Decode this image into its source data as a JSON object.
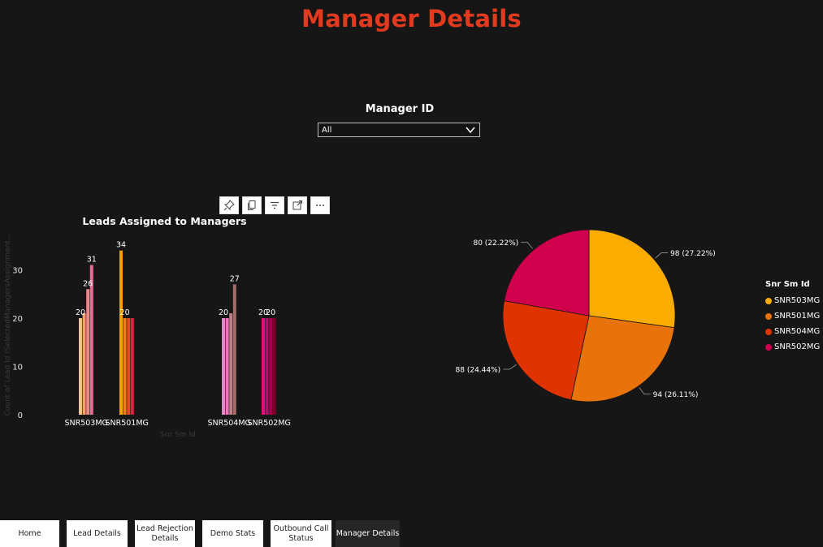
{
  "page": {
    "title": "Manager Details"
  },
  "slicer": {
    "title": "Manager ID",
    "selected": "All"
  },
  "visual_toolbar": {
    "icons": [
      "pin-icon",
      "copy-icon",
      "filter-icon",
      "focus-mode-icon",
      "more-options-icon"
    ]
  },
  "bar_chart": {
    "title": "Leads Assigned to Managers",
    "y_axis_title": "Count of Lead Id (SelectedManagersAssignment...",
    "x_axis_title": "Snr Sm Id"
  },
  "chart_data": [
    {
      "type": "bar",
      "title": "Leads Assigned to Managers",
      "xlabel": "Snr Sm Id",
      "ylabel": "Count of Lead Id (SelectedManagersAssignment...",
      "ylim": [
        0,
        35
      ],
      "y_ticks": [
        0,
        10,
        20,
        30
      ],
      "categories": [
        "SNR503MG",
        "SNR501MG",
        "SNR504MG",
        "SNR502MG"
      ],
      "groups": [
        {
          "category": "SNR503MG",
          "bars": [
            {
              "value": 20,
              "color": "#f2c878",
              "label": "20"
            },
            {
              "value": 21,
              "color": "#f0a070",
              "label": ""
            },
            {
              "value": 26,
              "color": "#ea8a8a",
              "label": "26"
            },
            {
              "value": 31,
              "color": "#e86a94",
              "label": "31"
            }
          ]
        },
        {
          "category": "SNR501MG",
          "bars": [
            {
              "value": 34,
              "color": "#f5a200",
              "label": "34"
            },
            {
              "value": 20,
              "color": "#f07e1a",
              "label": "20"
            },
            {
              "value": 20,
              "color": "#ea4a22",
              "label": ""
            },
            {
              "value": 20,
              "color": "#e02040",
              "label": ""
            }
          ]
        },
        {
          "category": "SNR504MG",
          "bars": [
            {
              "value": 20,
              "color": "#f080c8",
              "label": "20"
            },
            {
              "value": 20,
              "color": "#e87abd",
              "label": ""
            },
            {
              "value": 21,
              "color": "#c0808a",
              "label": ""
            },
            {
              "value": 27,
              "color": "#a56a6a",
              "label": "27"
            }
          ]
        },
        {
          "category": "SNR502MG",
          "bars": [
            {
              "value": 20,
              "color": "#e0107a",
              "label": "20"
            },
            {
              "value": 20,
              "color": "#c00a6a",
              "label": ""
            },
            {
              "value": 20,
              "color": "#a00050",
              "label": "20"
            },
            {
              "value": 20,
              "color": "#7a002a",
              "label": ""
            }
          ]
        }
      ]
    },
    {
      "type": "pie",
      "legend_title": "Snr Sm Id",
      "legend_position": "right",
      "slices": [
        {
          "name": "SNR503MG",
          "value": 98,
          "label": "98 (27.22%)",
          "color": "#fbac00"
        },
        {
          "name": "SNR501MG",
          "value": 94,
          "label": "94 (26.11%)",
          "color": "#e8730a"
        },
        {
          "name": "SNR504MG",
          "value": 88,
          "label": "88 (24.44%)",
          "color": "#e03303"
        },
        {
          "name": "SNR502MG",
          "value": 80,
          "label": "80 (22.22%)",
          "color": "#d1004c"
        }
      ]
    }
  ],
  "legend": {
    "title": "Snr Sm Id",
    "items": [
      {
        "label": "SNR503MG",
        "color": "#fbac00"
      },
      {
        "label": "SNR501MG",
        "color": "#e8730a"
      },
      {
        "label": "SNR504MG",
        "color": "#e03303"
      },
      {
        "label": "SNR502MG",
        "color": "#d1004c"
      }
    ]
  },
  "tabs": [
    {
      "label": "Home",
      "active": false
    },
    {
      "label": "Lead Details",
      "active": false
    },
    {
      "label": "Lead Rejection Details",
      "active": false
    },
    {
      "label": "Demo Stats",
      "active": false
    },
    {
      "label": "Outbound Call Status",
      "active": false
    },
    {
      "label": "Manager Details",
      "active": true
    }
  ]
}
